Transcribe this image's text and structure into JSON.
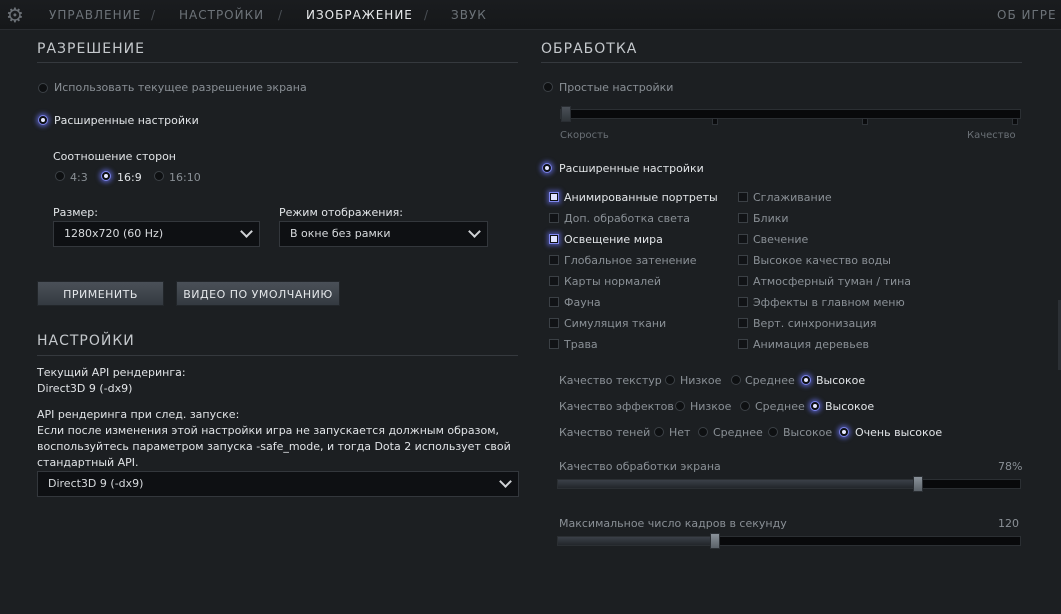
{
  "nav": {
    "tabs": [
      "УПРАВЛЕНИЕ",
      "НАСТРОЙКИ",
      "ИЗОБРАЖЕНИЕ",
      "ЗВУК"
    ],
    "active_tab": "ИЗОБРАЖЕНИЕ",
    "separator": "/",
    "about": "ОБ ИГРЕ"
  },
  "resolution": {
    "title": "РАЗРЕШЕНИЕ",
    "use_current": "Использовать текущее разрешение экрана",
    "advanced": "Расширенные настройки",
    "aspect_label": "Соотношение сторон",
    "aspect_options": [
      "4:3",
      "16:9",
      "16:10"
    ],
    "aspect_selected": "16:9",
    "size_label": "Размер:",
    "size_value": "1280x720 (60 Hz)",
    "mode_label": "Режим отображения:",
    "mode_value": "В окне без рамки",
    "apply_button": "ПРИМЕНИТЬ",
    "default_button": "ВИДЕО ПО УМОЛЧАНИЮ"
  },
  "settings": {
    "title": "НАСТРОЙКИ",
    "current_api_label": "Текущий API рендеринга:",
    "current_api_value": "Direct3D 9 (-dx9)",
    "next_api_label": "API рендеринга при след. запуске:",
    "next_api_note_1": "Если после изменения этой настройки игра не запускается должным образом,",
    "next_api_note_2": "воспользуйтесь параметром запуска -safe_mode, и тогда Dota 2 использует свой",
    "next_api_note_3": "стандартный API.",
    "api_dropdown_value": "Direct3D 9 (-dx9)"
  },
  "processing": {
    "title": "ОБРАБОТКА",
    "simple": "Простые настройки",
    "speed_label": "Скорость",
    "quality_label": "Качество",
    "advanced": "Расширенные настройки",
    "checkboxes_left": [
      {
        "label": "Анимированные портреты",
        "checked": true
      },
      {
        "label": "Доп. обработка света",
        "checked": false
      },
      {
        "label": "Освещение мира",
        "checked": true
      },
      {
        "label": "Глобальное затенение",
        "checked": false
      },
      {
        "label": "Карты нормалей",
        "checked": false
      },
      {
        "label": "Фауна",
        "checked": false
      },
      {
        "label": "Симуляция ткани",
        "checked": false
      },
      {
        "label": "Трава",
        "checked": false
      }
    ],
    "checkboxes_right": [
      {
        "label": "Сглаживание",
        "checked": false
      },
      {
        "label": "Блики",
        "checked": false
      },
      {
        "label": "Свечение",
        "checked": false
      },
      {
        "label": "Высокое качество воды",
        "checked": false
      },
      {
        "label": "Атмосферный туман / тина",
        "checked": false
      },
      {
        "label": "Эффекты в главном меню",
        "checked": false
      },
      {
        "label": "Верт. синхронизация",
        "checked": false
      },
      {
        "label": "Анимация деревьев",
        "checked": false
      }
    ],
    "texture_quality": {
      "label": "Качество текстур",
      "options": [
        "Низкое",
        "Среднее",
        "Высокое"
      ],
      "selected": "Высокое"
    },
    "effects_quality": {
      "label": "Качество эффектов",
      "options": [
        "Низкое",
        "Среднее",
        "Высокое"
      ],
      "selected": "Высокое"
    },
    "shadow_quality": {
      "label": "Качество теней",
      "options": [
        "Нет",
        "Среднее",
        "Высокое",
        "Очень высокое"
      ],
      "selected": "Очень высокое"
    },
    "screen_quality_label": "Качество обработки экрана",
    "screen_quality_value": "78%",
    "screen_quality_fraction": 0.78,
    "max_fps_label": "Максимальное число кадров в секунду",
    "max_fps_value": "120",
    "max_fps_fraction": 0.34
  },
  "colors": {
    "accent": "#7b83e8",
    "background": "#1c1f22"
  }
}
